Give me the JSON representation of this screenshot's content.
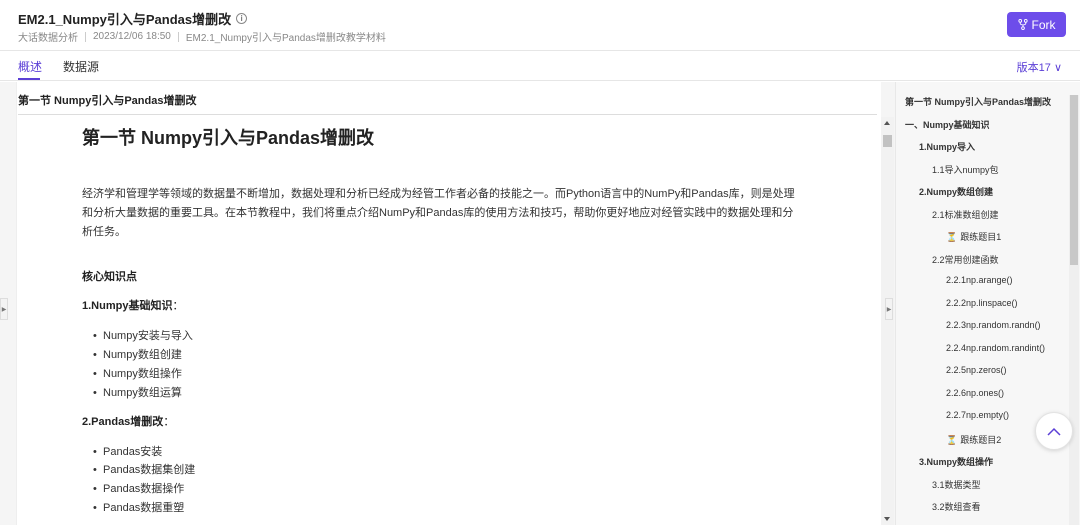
{
  "header": {
    "title": "EM2.1_Numpy引入与Pandas增删改",
    "info_icon": "info-icon",
    "meta": [
      "大话数据分析",
      "2023/12/06 18:50",
      "EM2.1_Numpy引入与Pandas增删改教学材料"
    ],
    "fork_label": "Fork",
    "fork_icon": "fork-icon",
    "accent_color": "#6d4dea"
  },
  "tabs": {
    "items": [
      "概述",
      "数据源"
    ],
    "active": "概述",
    "version": "版本17 ∨"
  },
  "doc": {
    "header": "第一节 Numpy引入与Pandas增删改",
    "h1": "第一节 Numpy引入与Pandas增删改",
    "intro": "经济学和管理学等领域的数据量不断增加，数据处理和分析已经成为经管工作者必备的技能之一。而Python语言中的NumPy和Pandas库，则是处理和分析大量数据的重要工具。在本节教程中，我们将重点介绍NumPy和Pandas库的使用方法和技巧，帮助你更好地应对经管实践中的数据处理和分析任务。",
    "core": "核心知识点",
    "s1": "1.Numpy基础知识",
    "s1_colon": "：",
    "s1_items": [
      "Numpy安装与导入",
      "Numpy数组创建",
      "Numpy数组操作",
      "Numpy数组运算"
    ],
    "s2": "2.Pandas增删改",
    "s2_colon": "：",
    "s2_items": [
      "Pandas安装",
      "Pandas数据集创建",
      "Pandas数据操作",
      "Pandas数据重塑"
    ]
  },
  "toc": {
    "items": [
      {
        "label": "第一节 Numpy引入与Pandas增删改",
        "level": 0,
        "bold": true
      },
      {
        "label": "一、Numpy基础知识",
        "level": 0,
        "bold": true
      },
      {
        "label": "1.Numpy导入",
        "level": 1,
        "bold": true
      },
      {
        "label": "1.1导入numpy包",
        "level": 2,
        "bold": false
      },
      {
        "label": "2.Numpy数组创建",
        "level": 1,
        "bold": true
      },
      {
        "label": "2.1标准数组创建",
        "level": 2,
        "bold": false
      },
      {
        "label": "跟练题目1",
        "level": 3,
        "bold": false,
        "icon": "hourglass-icon"
      },
      {
        "label": "2.2常用创建函数",
        "level": 2,
        "bold": false
      },
      {
        "label": "2.2.1np.arange()",
        "level": 3,
        "bold": false
      },
      {
        "label": "2.2.2np.linspace()",
        "level": 3,
        "bold": false
      },
      {
        "label": "2.2.3np.random.randn()",
        "level": 3,
        "bold": false
      },
      {
        "label": "2.2.4np.random.randint()",
        "level": 3,
        "bold": false
      },
      {
        "label": "2.2.5np.zeros()",
        "level": 3,
        "bold": false
      },
      {
        "label": "2.2.6np.ones()",
        "level": 3,
        "bold": false
      },
      {
        "label": "2.2.7np.empty()",
        "level": 3,
        "bold": false
      },
      {
        "label": "跟练题目2",
        "level": 3,
        "bold": false,
        "icon": "hourglass-icon"
      },
      {
        "label": "3.Numpy数组操作",
        "level": 1,
        "bold": true
      },
      {
        "label": "3.1数据类型",
        "level": 2,
        "bold": false
      },
      {
        "label": "3.2数组查看",
        "level": 2,
        "bold": false
      }
    ]
  }
}
